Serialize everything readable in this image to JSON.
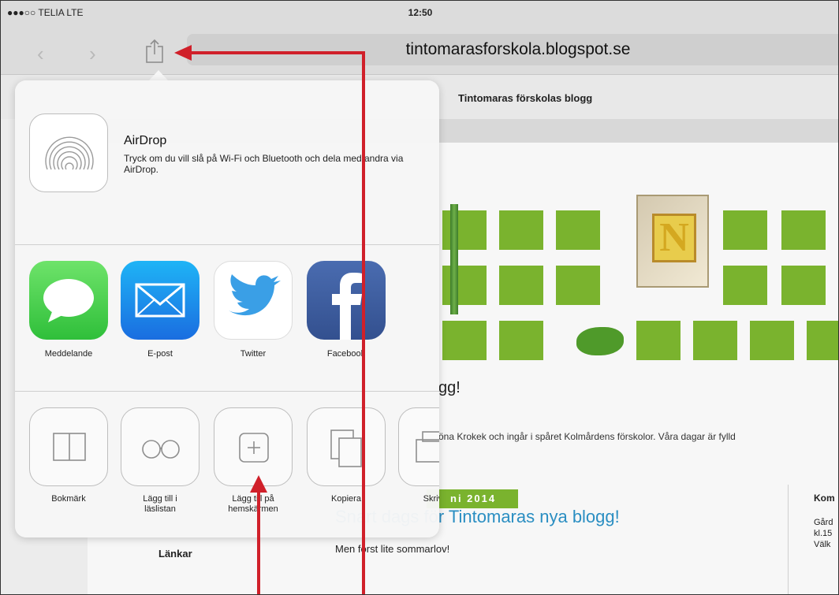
{
  "status_bar": {
    "carrier": "●●●○○ TELIA  LTE",
    "time": "12:50"
  },
  "toolbar": {
    "back_glyph": "‹",
    "forward_glyph": "›",
    "url": "tintomarasforskola.blogspot.se"
  },
  "blog": {
    "title": "Tintomaras förskolas blogg",
    "welcome": "gg!",
    "intro": "öna Krokek och ingår i spåret Kolmårdens förskolor. Våra dagar är fylld",
    "date_badge": "ni 2014",
    "post_title": "Snart dags för Tintomaras nya blogg!",
    "post_text": "Men först lite sommarlov!",
    "sidebar_links": "Länkar",
    "right_col": {
      "head": "Kom",
      "lines": [
        "Gård",
        "kl.15",
        "Välk"
      ]
    },
    "block_letter": "N"
  },
  "share_sheet": {
    "airdrop": {
      "title": "AirDrop",
      "description": "Tryck om du vill slå på Wi-Fi och Bluetooth och dela med andra via AirDrop."
    },
    "apps": [
      {
        "label": "Meddelande",
        "icon": "messages-icon",
        "color": "#3ed256"
      },
      {
        "label": "E-post",
        "icon": "mail-icon",
        "color": "#2a8ef2"
      },
      {
        "label": "Twitter",
        "icon": "twitter-icon",
        "color": "#ffffff"
      },
      {
        "label": "Facebook",
        "icon": "facebook-icon",
        "color": "#3a5a9c"
      }
    ],
    "actions": [
      {
        "label": "Bokmärk",
        "icon": "book-icon"
      },
      {
        "label": "Lägg till i läslistan",
        "icon": "glasses-icon"
      },
      {
        "label": "Lägg till på hemskärmen",
        "icon": "add-to-home-icon"
      },
      {
        "label": "Kopiera",
        "icon": "copy-icon"
      },
      {
        "label": "Skriv ut",
        "icon": "print-icon"
      }
    ]
  },
  "colors": {
    "annotation_arrow": "#d0202a",
    "blog_green": "#7ab32e",
    "link_blue": "#2a8ec2"
  }
}
